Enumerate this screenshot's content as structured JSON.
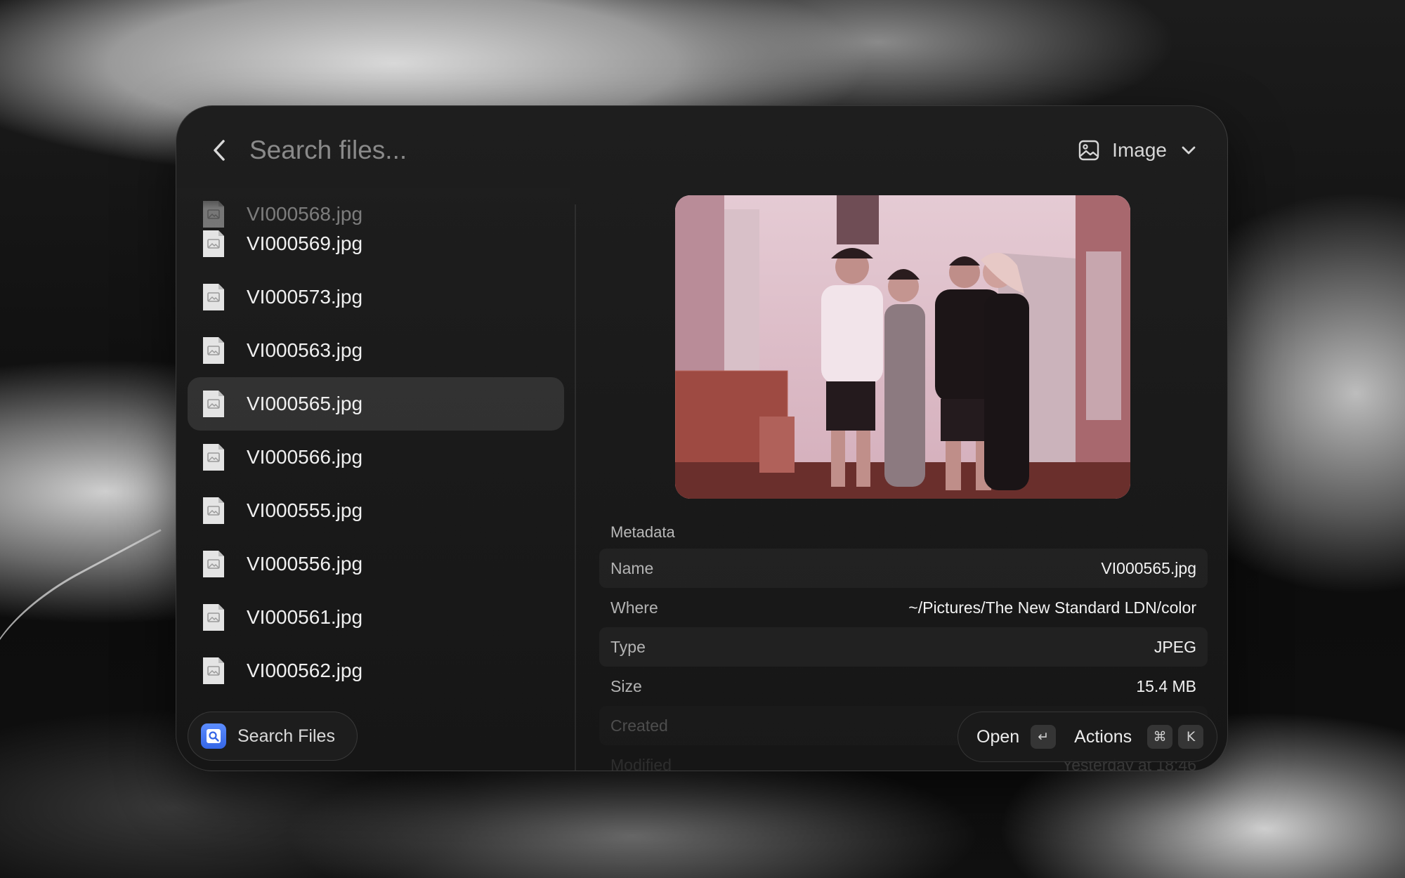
{
  "search": {
    "placeholder": "Search files..."
  },
  "filter": {
    "label": "Image"
  },
  "files": [
    {
      "name": "VI000568.jpg"
    },
    {
      "name": "VI000569.jpg"
    },
    {
      "name": "VI000573.jpg"
    },
    {
      "name": "VI000563.jpg"
    },
    {
      "name": "VI000565.jpg"
    },
    {
      "name": "VI000566.jpg"
    },
    {
      "name": "VI000555.jpg"
    },
    {
      "name": "VI000556.jpg"
    },
    {
      "name": "VI000561.jpg"
    },
    {
      "name": "VI000562.jpg"
    }
  ],
  "selected_file": "VI000565.jpg",
  "metadata": {
    "title": "Metadata",
    "rows": [
      {
        "key": "Name",
        "value": "VI000565.jpg"
      },
      {
        "key": "Where",
        "value": "~/Pictures/The New Standard LDN/color"
      },
      {
        "key": "Type",
        "value": "JPEG"
      },
      {
        "key": "Size",
        "value": "15.4 MB"
      },
      {
        "key": "Created",
        "value": ""
      },
      {
        "key": "Modified",
        "value": "Yesterday at 18:46"
      }
    ]
  },
  "footer": {
    "app_label": "Search Files",
    "open_label": "Open",
    "open_key": "↵",
    "actions_label": "Actions",
    "actions_key1": "⌘",
    "actions_key2": "K"
  },
  "icons": {
    "back": "chevron-left-icon",
    "filter": "image-icon",
    "filter_toggle": "chevron-down-icon",
    "file": "jpg-file-icon",
    "app": "search-files-app-icon"
  },
  "colors": {
    "accent": "#3f74f0",
    "selected_row": "#2e2e2e"
  }
}
